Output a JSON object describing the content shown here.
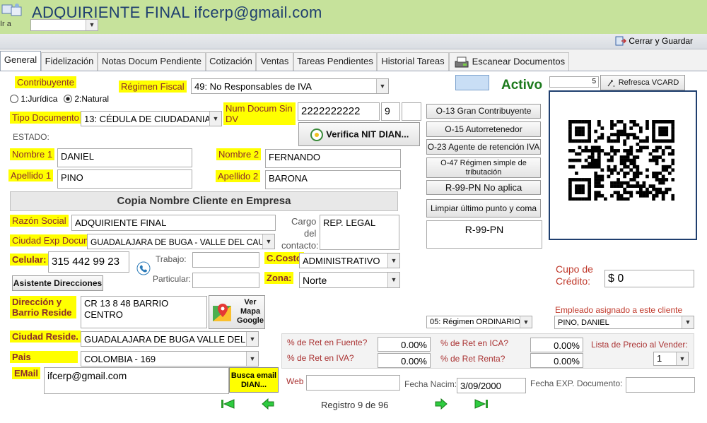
{
  "header": {
    "title": "ADQUIRIENTE  FINAL ifcerp@gmail.com",
    "ira_label": "Ir a"
  },
  "toolbar": {
    "close_save": "Cerrar y Guardar"
  },
  "tabs": [
    "General",
    "Fidelización",
    "Notas Docum Pendiente",
    "Cotización",
    "Ventas",
    "Tareas Pendientes",
    "Historial Tareas",
    "Escanear Documentos"
  ],
  "form": {
    "contribuyente_label": "Contribuyente",
    "opt_juridica": "1:Jurídica",
    "opt_natural": "2:Natural",
    "regimen_fiscal_label": "Régimen Fiscal",
    "regimen_fiscal_value": "49: No Responsables de IVA",
    "tipo_doc_label": "Tipo Documento",
    "tipo_doc_value": "13: CÉDULA DE CIUDADANIA",
    "num_doc_label": "Num Docum Sin DV",
    "num_doc_value": "2222222222",
    "dv_value": "9",
    "estado_label": "ESTADO:",
    "verifica_button": "Verifica NIT DIAN...",
    "nombre1_label": "Nombre 1",
    "nombre1_value": "DANIEL",
    "nombre2_label": "Nombre 2",
    "nombre2_value": "FERNANDO",
    "apellido1_label": "Apellido 1",
    "apellido1_value": "PINO",
    "apellido2_label": "Apellido 2",
    "apellido2_value": "BARONA",
    "copia_button": "Copia Nombre Cliente en Empresa",
    "razon_label": "Razón Social",
    "razon_value": "ADQUIRIENTE  FINAL",
    "cargo_label_1": "Cargo",
    "cargo_label_2": "del",
    "cargo_label_3": "contacto:",
    "cargo_value": "REP. LEGAL",
    "ciudad_exp_label": "Ciudad Exp Docum",
    "ciudad_exp_value": "GUADALAJARA DE BUGA - VALLE DEL CAUCA",
    "celular_label": "Celular:",
    "celular_value": "315 442 99 23",
    "trabajo_label": "Trabajo:",
    "particular_label": "Particular:",
    "ccosto_label": "C.Costo",
    "ccosto_value": "ADMINISTRATIVO",
    "zona_label": "Zona:",
    "zona_value": "Norte",
    "asistente_button": "Asistente Direcciones",
    "direccion_label": "Dirección y Barrio Reside",
    "direccion_line1": "CR 13 8 48 BARRIO",
    "direccion_line2": "CENTRO",
    "mapa_button": "Ver Mapa Google",
    "ciudad_res_label": "Ciudad Reside.",
    "ciudad_res_value": "GUADALAJARA DE BUGA  VALLE DEL CA",
    "pais_label": "Pais",
    "pais_value": "COLOMBIA - 169",
    "email_label": "EMail",
    "email_value": "ifcerp@gmail.com",
    "busca_email_button": "Busca email DIAN...",
    "web_label": "Web",
    "fecha_nacim_label": "Fecha Nacim:",
    "fecha_nacim_value": "3/09/2000",
    "fecha_exp_label": "Fecha EXP. Documento:"
  },
  "right": {
    "activo": "Activo",
    "vcard_num": "5",
    "refresca_button": "Refresca VCARD",
    "o13": "O-13 Gran Contribuyente",
    "o15": "O-15 Autorretenedor",
    "o23": "O-23 Agente de retención IVA",
    "o47": "O-47 Régimen simple de tributación",
    "r99": "R-99-PN No aplica",
    "limpiar": "Limpiar último punto y coma",
    "resp_value": "R-99-PN",
    "cupo_label": "Cupo de Crédito:",
    "cupo_value": "$ 0",
    "empleado_label": "Empleado asignado a este cliente",
    "empleado_value": "PINO, DANIEL",
    "regimen_value": "05: Régimen ORDINARIO",
    "lista_label": "Lista de Precio al Vender:",
    "lista_value": "1"
  },
  "retenciones": {
    "fuente_label": "% de Ret en Fuente?",
    "fuente_value": "0.00%",
    "iva_label": "% de Ret en IVA?",
    "iva_value": "0.00%",
    "ica_label": "% de Ret en ICA?",
    "ica_value": "0.00%",
    "renta_label": "% de Ret Renta?",
    "renta_value": "0.00%"
  },
  "nav": {
    "registro": "Registro 9 de 96"
  },
  "colors": {
    "header_bg": "#c6e29b",
    "label_bg": "#ffff00",
    "activo": "#1d7a1d",
    "accent": "#1f3f6f"
  }
}
